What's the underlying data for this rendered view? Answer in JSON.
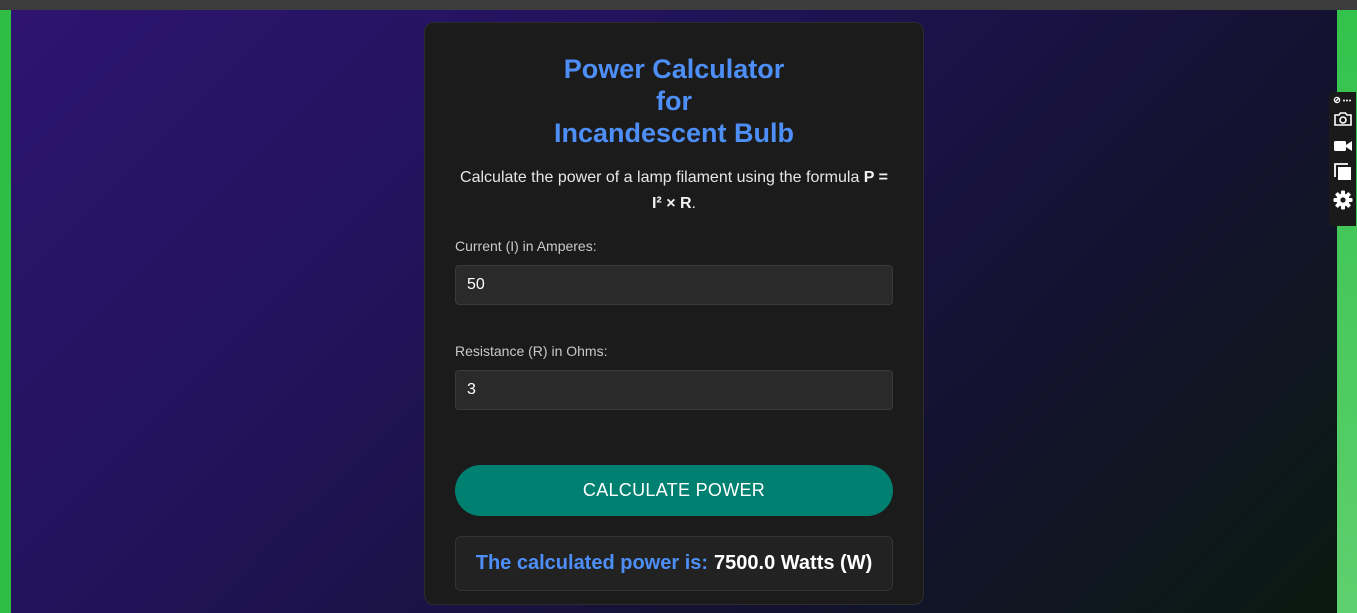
{
  "app": {
    "title_line1": "Power Calculator for",
    "title_line2": "Incandescent Bulb",
    "description_prefix": "Calculate the power of a lamp filament using the formula ",
    "description_formula_part1": "P =",
    "description_formula_part2": "I² × R",
    "description_suffix": "."
  },
  "form": {
    "current_label": "Current (I) in Amperes:",
    "current_value": "50",
    "resistance_label": "Resistance (R) in Ohms:",
    "resistance_value": "3",
    "button_label": "CALCULATE POWER"
  },
  "result": {
    "prefix": "The calculated power is:",
    "value": "7500.0 Watts (W)"
  },
  "toolbar": {
    "icons": [
      "link-more-icon",
      "camera-icon",
      "video-icon",
      "window-stack-icon",
      "gear-icon"
    ]
  },
  "colors": {
    "accent_blue": "#4d8ef7",
    "button_teal": "#008070",
    "card_bg": "#1b1b1b",
    "frame_green": "#2fbd46"
  }
}
